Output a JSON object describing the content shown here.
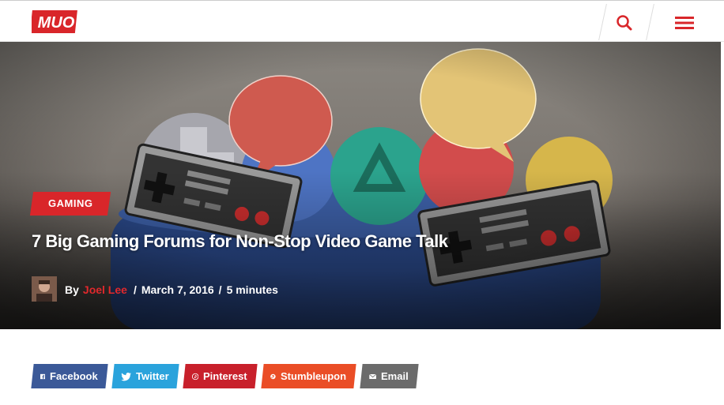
{
  "header": {
    "logo_text": "MUO",
    "brand_color": "#d9262a"
  },
  "hero": {
    "category": "GAMING",
    "title": "7 Big Gaming Forums for Non-Stop Video Game Talk",
    "byline_prefix": "By",
    "author": "Joel Lee",
    "separator": "/",
    "date": "March 7, 2016",
    "read_time": "5 minutes"
  },
  "share": {
    "facebook": "Facebook",
    "twitter": "Twitter",
    "pinterest": "Pinterest",
    "stumbleupon": "Stumbleupon",
    "email": "Email"
  },
  "icons": [
    "search-icon",
    "hamburger-menu-icon",
    "facebook-icon",
    "twitter-icon",
    "pinterest-icon",
    "stumbleupon-icon",
    "email-icon"
  ]
}
